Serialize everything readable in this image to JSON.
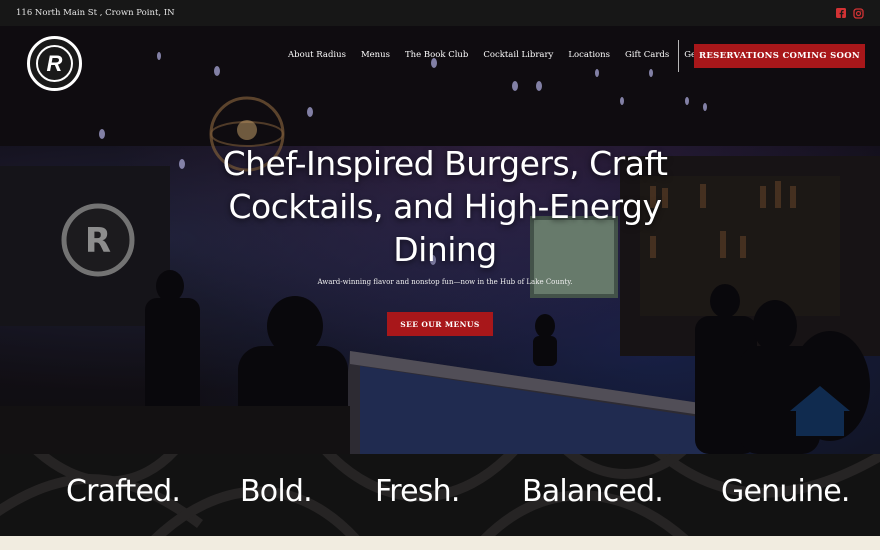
{
  "topbar": {
    "address": "116 North Main St , Crown Point, IN",
    "social": [
      {
        "name": "facebook-icon",
        "color": "#d23234"
      },
      {
        "name": "instagram-icon",
        "color": "#d23234"
      }
    ]
  },
  "header": {
    "logo_letter": "R",
    "nav": [
      "About Radius",
      "Menus",
      "The Book Club",
      "Cocktail Library",
      "Locations",
      "Gift Cards",
      "Get In Touch"
    ],
    "reservations_label": "RESERVATIONS COMING SOON"
  },
  "hero": {
    "headline": "Chef-Inspired Burgers, Craft Cocktails, and High-Energy Dining",
    "subline": "Award-winning flavor and nonstop fun—now in the Hub of Lake County.",
    "cta_label": "SEE OUR MENUS"
  },
  "pillars": [
    "Crafted.",
    "Bold.",
    "Fresh.",
    "Balanced.",
    "Genuine."
  ],
  "colors": {
    "accent": "#a8171a",
    "topbar": "#171717",
    "cream": "#f1ece0"
  }
}
